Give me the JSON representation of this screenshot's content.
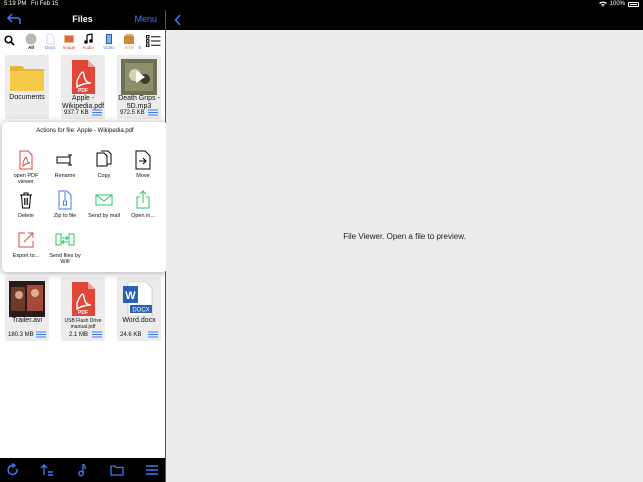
{
  "status": {
    "time": "5:19 PM",
    "date": "Fri Feb 15",
    "battery": "100%"
  },
  "nav": {
    "title": "Files",
    "menu_label": "Menu"
  },
  "filters": [
    {
      "label": "All",
      "icon": "all-icon",
      "color": "#000000"
    },
    {
      "label": "Docs",
      "icon": "docs-icon",
      "color": "#3d7bf2"
    },
    {
      "label": "Image",
      "icon": "image-icon",
      "color": "#e0463a"
    },
    {
      "label": "Audio",
      "icon": "audio-icon",
      "color": "#e0463a"
    },
    {
      "label": "Video",
      "icon": "video-icon",
      "color": "#3d7bf2"
    },
    {
      "label": "Arch",
      "icon": "archive-icon",
      "color": "#e08a1e"
    },
    {
      "label": "E",
      "icon": "other-icon",
      "color": "#3d7bf2"
    }
  ],
  "files": [
    {
      "name": "Documents",
      "size": "",
      "kind": "folder"
    },
    {
      "name": "Apple - Wikipedia.pdf",
      "size": "937.7 KB",
      "kind": "pdf"
    },
    {
      "name": "Death Grips - 5D.mp3",
      "size": "972.5 KB",
      "kind": "audio"
    },
    {
      "name": "Trailer.avi",
      "size": "180.3 MB",
      "kind": "video"
    },
    {
      "name": "USB Flash Drive manual.pdf",
      "size": "2.1 MB",
      "kind": "pdf"
    },
    {
      "name": "Word.docx",
      "size": "24.6 KB",
      "kind": "docx"
    }
  ],
  "popover": {
    "title": "Actions for file: Apple - Wikipedia.pdf",
    "actions": [
      {
        "label": "open PDF viewer",
        "icon": "pdf-icon"
      },
      {
        "label": "Rename",
        "icon": "rename-icon"
      },
      {
        "label": "Copy",
        "icon": "copy-icon"
      },
      {
        "label": "Move",
        "icon": "move-icon"
      },
      {
        "label": "Delete",
        "icon": "trash-icon"
      },
      {
        "label": "Zip to file",
        "icon": "zip-icon"
      },
      {
        "label": "Send by mail",
        "icon": "mail-icon"
      },
      {
        "label": "Open in...",
        "icon": "share-icon"
      },
      {
        "label": "Export to...",
        "icon": "export-icon"
      },
      {
        "label": "Send files by Wifi",
        "icon": "wifi-transfer-icon"
      }
    ]
  },
  "viewer": {
    "message": "File Viewer. Open a file to preview."
  },
  "colors": {
    "accent": "#3d7bf2",
    "pdf_red": "#e0463a",
    "green": "#2fc46a",
    "folder": "#f7c948"
  }
}
